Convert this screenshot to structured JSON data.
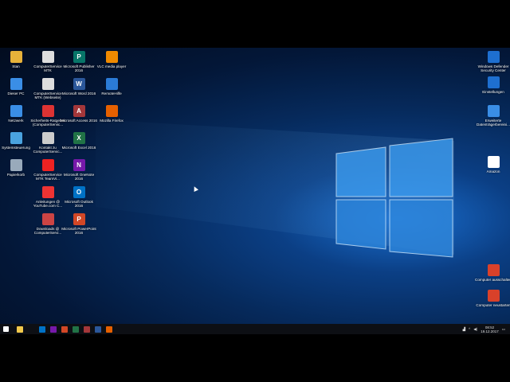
{
  "desktop": {
    "icons_col1": [
      {
        "label": "Stan",
        "icon": "user-folder-icon",
        "color": "#e7b23a"
      },
      {
        "label": "Dieser PC",
        "icon": "computer-icon",
        "color": "#3a8ee6"
      },
      {
        "label": "Netzwerk",
        "icon": "network-icon",
        "color": "#3a8ee6"
      },
      {
        "label": "Systemsteuerung",
        "icon": "control-panel-icon",
        "color": "#4aa3df"
      },
      {
        "label": "Papierkorb",
        "icon": "recycle-bin-icon",
        "color": "#9ab"
      }
    ],
    "icons_col2": [
      {
        "label": "ComputerService MTK",
        "icon": "document-icon",
        "color": "#ddd"
      },
      {
        "label": "ComputerService MTK (Webseite)",
        "icon": "web-shortcut-icon",
        "color": "#ddd"
      },
      {
        "label": "Sicherheits-Ratgeber (ComputerServic...",
        "icon": "pdf-icon",
        "color": "#d33"
      },
      {
        "label": "Kontakt zu ComputerServic...",
        "icon": "contact-icon",
        "color": "#ccc"
      },
      {
        "label": "ComputerService MTK TeamVi...",
        "icon": "red-cross-icon",
        "color": "#e22"
      },
      {
        "label": "Anleitungen @ YouTube.com C...",
        "icon": "youtube-icon",
        "color": "#e33"
      },
      {
        "label": "Downloads @ ComputerServi...",
        "icon": "downloads-icon",
        "color": "#c44"
      }
    ],
    "icons_col3": [
      {
        "label": "Microsoft Publisher 2016",
        "icon": "publisher-icon",
        "color": "#077568",
        "glyph": "P"
      },
      {
        "label": "Microsoft Word 2016",
        "icon": "word-icon",
        "color": "#2b579a",
        "glyph": "W"
      },
      {
        "label": "Microsoft Access 2016",
        "icon": "access-icon",
        "color": "#a4373a",
        "glyph": "A"
      },
      {
        "label": "Microsoft Excel 2016",
        "icon": "excel-icon",
        "color": "#217346",
        "glyph": "X"
      },
      {
        "label": "Microsoft OneNote 2016",
        "icon": "onenote-icon",
        "color": "#7719aa",
        "glyph": "N"
      },
      {
        "label": "Microsoft Outlook 2016",
        "icon": "outlook-icon",
        "color": "#0072c6",
        "glyph": "O"
      },
      {
        "label": "Microsoft PowerPoint 2016",
        "icon": "powerpoint-icon",
        "color": "#d24726",
        "glyph": "P"
      }
    ],
    "icons_col4": [
      {
        "label": "VLC media player",
        "icon": "vlc-icon",
        "color": "#f08a00"
      },
      {
        "label": "RemoteHilfe",
        "icon": "remote-help-icon",
        "color": "#2b7bd6"
      },
      {
        "label": "Mozilla Firefox",
        "icon": "firefox-icon",
        "color": "#e66000"
      }
    ],
    "icons_right": [
      {
        "label": "Windows Defender Security Center",
        "icon": "defender-icon",
        "color": "#1e6fd0"
      },
      {
        "label": "Einstellungen",
        "icon": "settings-gear-icon",
        "color": "#1e6fd0"
      },
      {
        "label": "Erweiterte Datenträgerbereini...",
        "icon": "disk-cleanup-icon",
        "color": "#3a8ee6"
      },
      {
        "label": "Amazon",
        "icon": "amazon-icon",
        "color": "#fff"
      },
      {
        "label": "Computer ausschalten",
        "icon": "power-off-icon",
        "color": "#d9412a"
      },
      {
        "label": "Computer neustarten",
        "icon": "restart-icon",
        "color": "#d9412a"
      }
    ]
  },
  "taskbar": {
    "apps": [
      {
        "name": "start-button",
        "color": "#ffffff"
      },
      {
        "name": "file-explorer",
        "color": "#f2c94c"
      },
      {
        "name": "outlook",
        "color": "#0072c6"
      },
      {
        "name": "onenote",
        "color": "#7719aa"
      },
      {
        "name": "powerpoint",
        "color": "#d24726"
      },
      {
        "name": "excel",
        "color": "#217346"
      },
      {
        "name": "access",
        "color": "#a4373a"
      },
      {
        "name": "word",
        "color": "#2b579a"
      },
      {
        "name": "firefox",
        "color": "#e66000"
      }
    ],
    "time": "08:52",
    "date": "19.12.2017"
  }
}
